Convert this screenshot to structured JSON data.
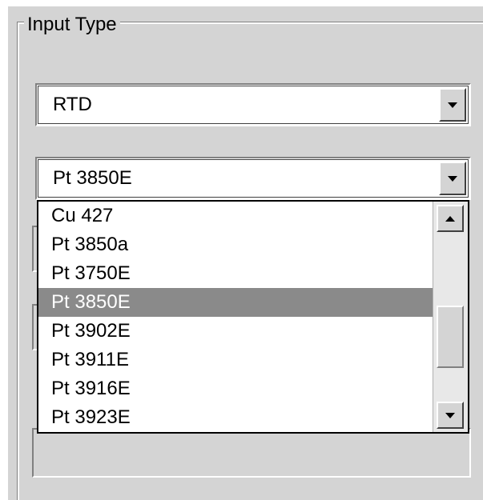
{
  "group": {
    "label": "Input Type"
  },
  "input_type_combo": {
    "value": "RTD",
    "icon": "chevron-down-icon"
  },
  "sensor_combo": {
    "value": "Pt 3850E",
    "icon": "chevron-down-icon",
    "options": [
      "Cu  427",
      "Pt 3850a",
      "Pt 3750E",
      "Pt 3850E",
      "Pt 3902E",
      "Pt 3911E",
      "Pt 3916E",
      "Pt 3923E"
    ],
    "selected_option": "Pt 3850E"
  },
  "scrollbar": {
    "up_icon": "scroll-up-icon",
    "down_icon": "scroll-down-icon"
  },
  "colors": {
    "panel": "#d4d4d4",
    "selection": "#8a8a8a",
    "selection_text": "#ffffff"
  }
}
